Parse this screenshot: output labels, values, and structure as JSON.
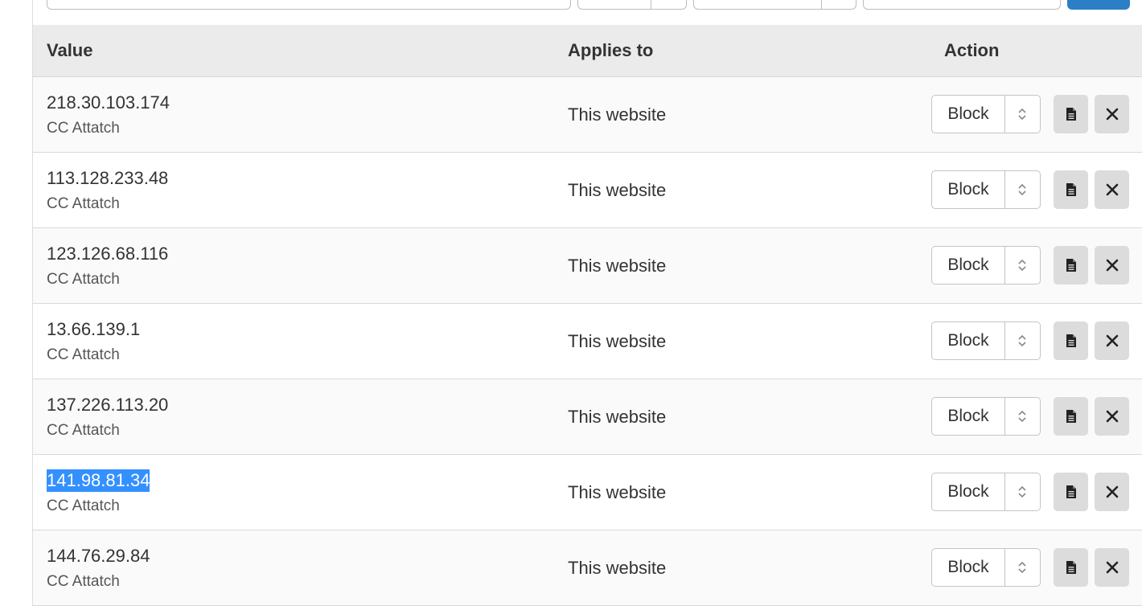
{
  "toolbar": {
    "search_value": "",
    "filter1_value": "",
    "filter2_value": "",
    "date_value": ""
  },
  "table": {
    "headers": {
      "value": "Value",
      "applies_to": "Applies to",
      "action": "Action"
    },
    "rows": [
      {
        "ip": "218.30.103.174",
        "note": "CC Attatch",
        "applies_to": "This website",
        "action": "Block"
      },
      {
        "ip": "113.128.233.48",
        "note": "CC Attatch",
        "applies_to": "This website",
        "action": "Block"
      },
      {
        "ip": "123.126.68.116",
        "note": "CC Attatch",
        "applies_to": "This website",
        "action": "Block"
      },
      {
        "ip": "13.66.139.1",
        "note": "CC Attatch",
        "applies_to": "This website",
        "action": "Block"
      },
      {
        "ip": "137.226.113.20",
        "note": "CC Attatch",
        "applies_to": "This website",
        "action": "Block"
      },
      {
        "ip": "141.98.81.34",
        "note": "CC Attatch",
        "applies_to": "This website",
        "action": "Block"
      },
      {
        "ip": "144.76.29.84",
        "note": "CC Attatch",
        "applies_to": "This website",
        "action": "Block"
      }
    ]
  },
  "icons": {
    "log": "file-text-icon",
    "delete": "close-icon",
    "spinner": "sort-updown-icon"
  },
  "colors": {
    "header_bg": "#ebebeb",
    "button_bg": "#dcdcdc",
    "primary": "#2a7fc6",
    "selection": "#3390ff"
  }
}
